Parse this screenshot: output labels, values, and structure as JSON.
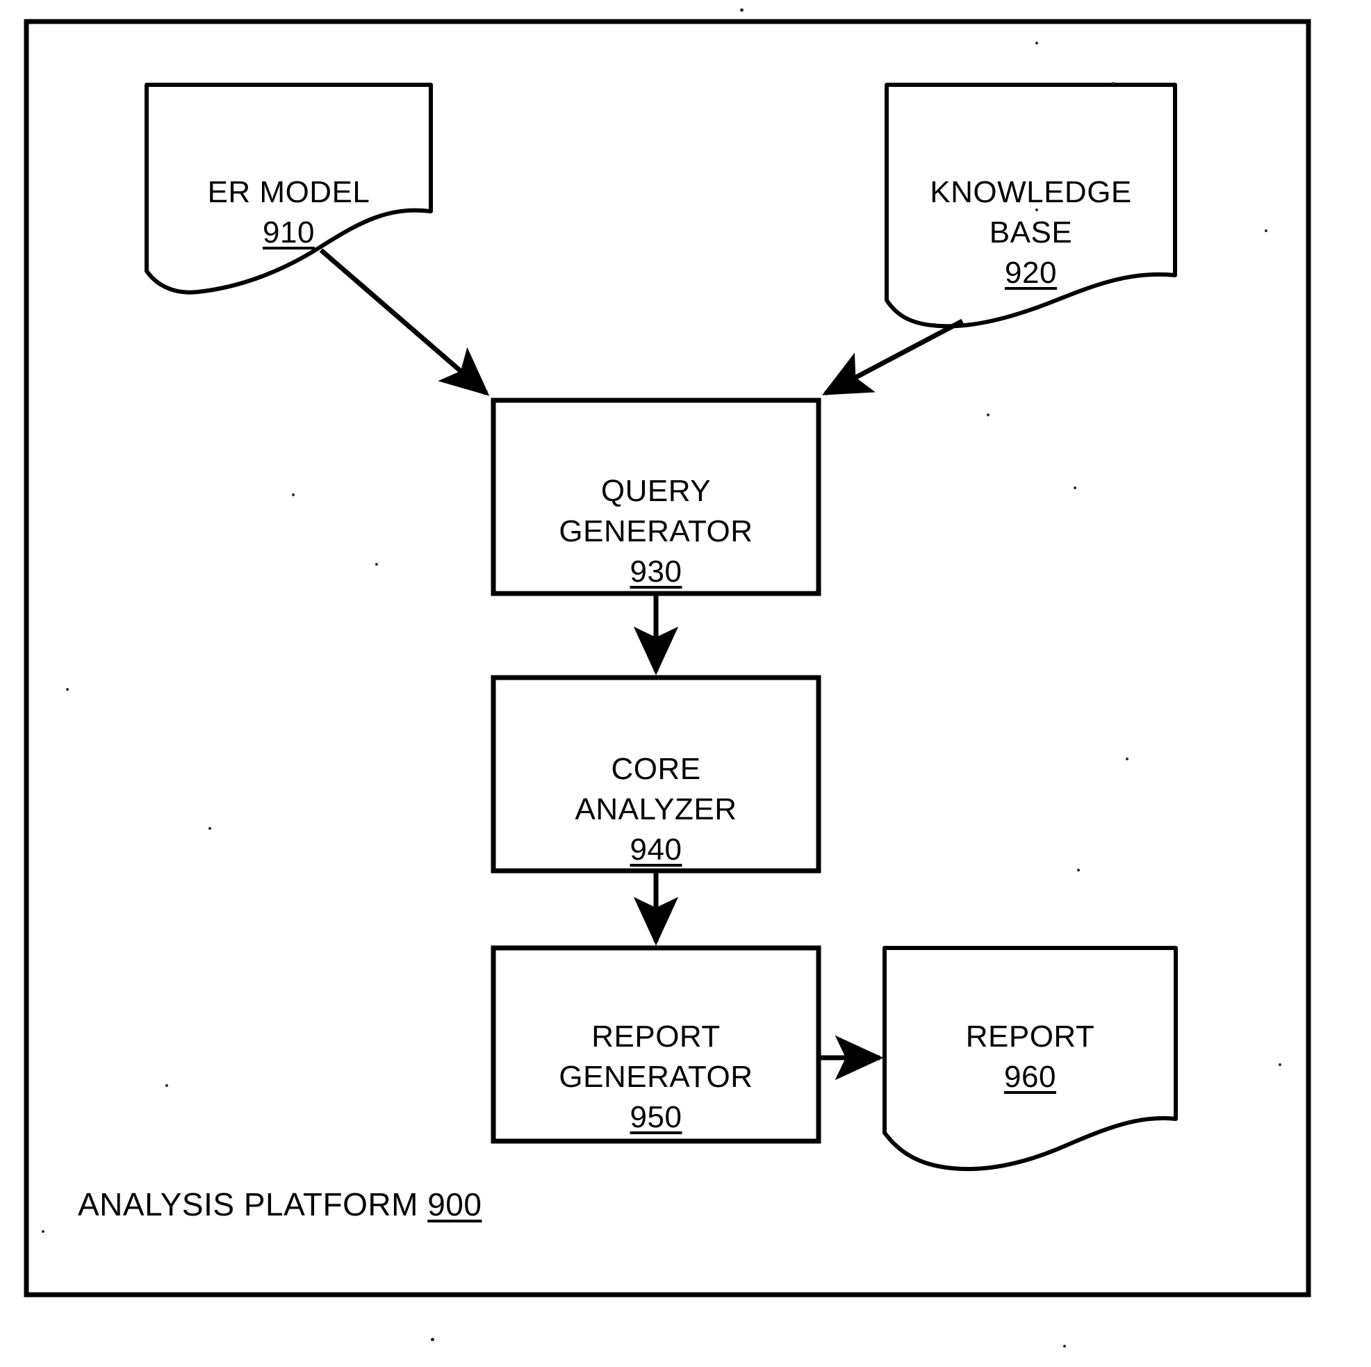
{
  "figure": {
    "container_label": "ANALYSIS PLATFORM",
    "container_ref": "900"
  },
  "nodes": [
    {
      "id": "er-model",
      "shape": "document",
      "title": "ER MODEL",
      "ref": "910"
    },
    {
      "id": "knowledge-base",
      "shape": "document",
      "title": "KNOWLEDGE\nBASE",
      "ref": "920"
    },
    {
      "id": "query-generator",
      "shape": "rectangle",
      "title": "QUERY\nGENERATOR",
      "ref": "930"
    },
    {
      "id": "core-analyzer",
      "shape": "rectangle",
      "title": "CORE\nANALYZER",
      "ref": "940"
    },
    {
      "id": "report-generator",
      "shape": "rectangle",
      "title": "REPORT\nGENERATOR",
      "ref": "950"
    },
    {
      "id": "report",
      "shape": "document",
      "title": "REPORT",
      "ref": "960"
    }
  ],
  "connections": [
    {
      "id": "er-model-to-query-generator",
      "from": "er-model",
      "to": "query-generator"
    },
    {
      "id": "knowledge-base-to-query-generator",
      "from": "knowledge-base",
      "to": "query-generator"
    },
    {
      "id": "query-generator-to-core-analyzer",
      "from": "query-generator",
      "to": "core-analyzer"
    },
    {
      "id": "core-analyzer-to-report-generator",
      "from": "core-analyzer",
      "to": "report-generator"
    },
    {
      "id": "report-generator-to-report",
      "from": "report-generator",
      "to": "report"
    }
  ],
  "colors": {
    "ink": "#000000",
    "paper": "#ffffff"
  }
}
